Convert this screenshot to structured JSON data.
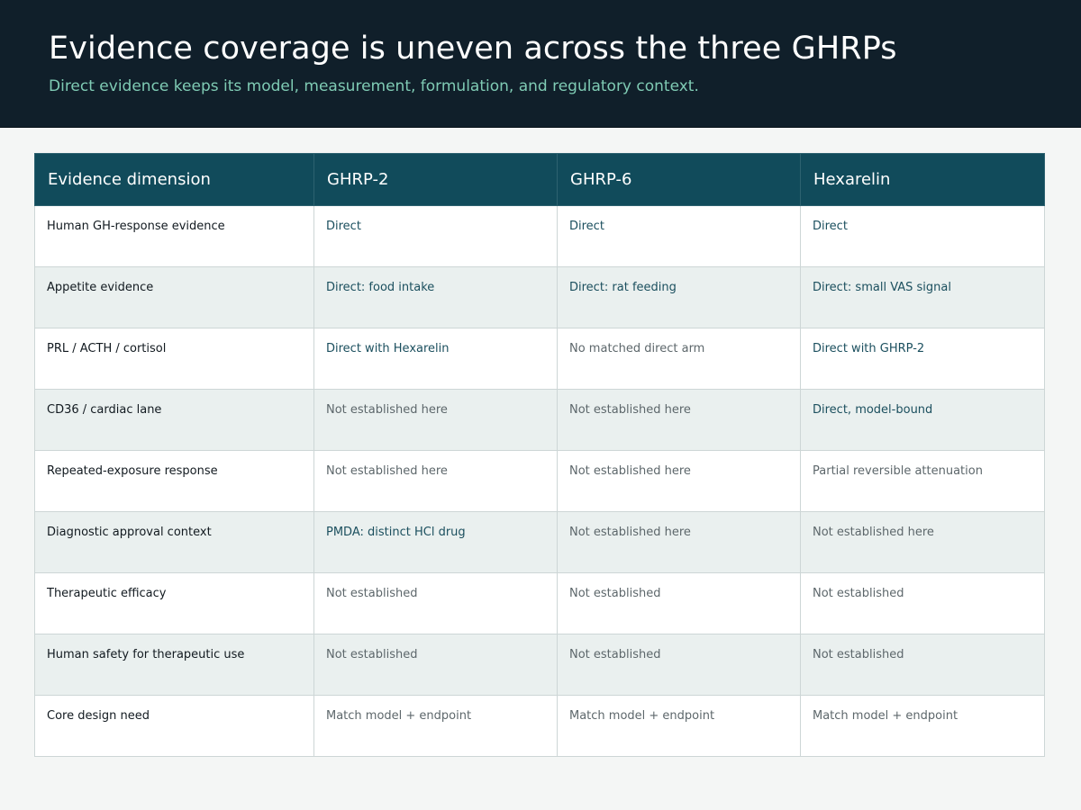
{
  "header": {
    "title": "Evidence coverage is uneven across the three GHRPs",
    "subtitle": "Direct evidence keeps its model, measurement, formulation, and regulatory context."
  },
  "table": {
    "columns": [
      "Evidence dimension",
      "GHRP-2",
      "GHRP-6",
      "Hexarelin"
    ],
    "rows": [
      {
        "label": "Human GH-response evidence",
        "cells": [
          {
            "text": "Direct",
            "status": "direct"
          },
          {
            "text": "Direct",
            "status": "direct"
          },
          {
            "text": "Direct",
            "status": "direct"
          }
        ]
      },
      {
        "label": "Appetite evidence",
        "cells": [
          {
            "text": "Direct: food intake",
            "status": "direct"
          },
          {
            "text": "Direct: rat feeding",
            "status": "direct"
          },
          {
            "text": "Direct: small VAS signal",
            "status": "direct"
          }
        ]
      },
      {
        "label": "PRL / ACTH / cortisol",
        "cells": [
          {
            "text": "Direct with Hexarelin",
            "status": "direct"
          },
          {
            "text": "No matched direct arm",
            "status": "muted"
          },
          {
            "text": "Direct with GHRP-2",
            "status": "direct"
          }
        ]
      },
      {
        "label": "CD36 / cardiac lane",
        "cells": [
          {
            "text": "Not established here",
            "status": "muted"
          },
          {
            "text": "Not established here",
            "status": "muted"
          },
          {
            "text": "Direct, model-bound",
            "status": "direct"
          }
        ]
      },
      {
        "label": "Repeated-exposure response",
        "cells": [
          {
            "text": "Not established here",
            "status": "muted"
          },
          {
            "text": "Not established here",
            "status": "muted"
          },
          {
            "text": "Partial reversible attenuation",
            "status": "muted"
          }
        ]
      },
      {
        "label": "Diagnostic approval context",
        "cells": [
          {
            "text": "PMDA: distinct HCl drug",
            "status": "direct"
          },
          {
            "text": "Not established here",
            "status": "muted"
          },
          {
            "text": "Not established here",
            "status": "muted"
          }
        ]
      },
      {
        "label": "Therapeutic efficacy",
        "cells": [
          {
            "text": "Not established",
            "status": "muted"
          },
          {
            "text": "Not established",
            "status": "muted"
          },
          {
            "text": "Not established",
            "status": "muted"
          }
        ]
      },
      {
        "label": "Human safety for therapeutic use",
        "cells": [
          {
            "text": "Not established",
            "status": "muted"
          },
          {
            "text": "Not established",
            "status": "muted"
          },
          {
            "text": "Not established",
            "status": "muted"
          }
        ]
      },
      {
        "label": "Core design need",
        "cells": [
          {
            "text": "Match model + endpoint",
            "status": "muted"
          },
          {
            "text": "Match model + endpoint",
            "status": "muted"
          },
          {
            "text": "Match model + endpoint",
            "status": "muted"
          }
        ]
      }
    ]
  },
  "colors": {
    "header_bg": "#101f2a",
    "subtitle": "#7fcbb4",
    "table_header_bg": "#114b5b",
    "direct_text": "#1b4f5e",
    "muted_text": "#5d676b",
    "stripe": "#eaf0ef"
  }
}
